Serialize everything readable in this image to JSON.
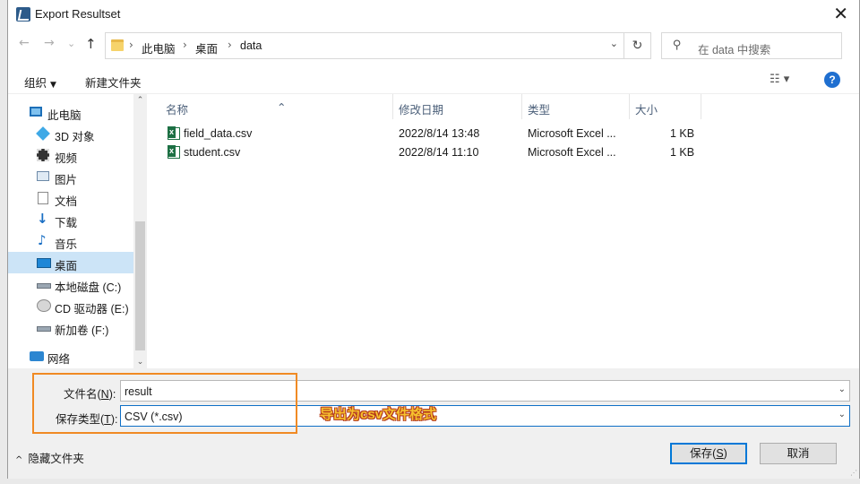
{
  "window": {
    "title": "Export Resultset",
    "close_glyph": "✕"
  },
  "nav_buttons": {
    "back": "←",
    "forward": "→",
    "recent": "⌄",
    "up": "↑"
  },
  "address": {
    "crumbs": [
      "此电脑",
      "桌面",
      "data"
    ],
    "separator": "›",
    "dropdown_glyph": "⌄",
    "refresh_glyph": "↻"
  },
  "search": {
    "placeholder": "在 data 中搜索",
    "icon": "⚲"
  },
  "toolbar": {
    "organize": "组织",
    "organize_arrow": "▼",
    "new_folder": "新建文件夹",
    "view_glyph": "☷ ▾",
    "help_glyph": "?"
  },
  "sidebar": {
    "items": [
      {
        "label": "此电脑",
        "icon": "computer-icon"
      },
      {
        "label": "3D 对象",
        "icon": "cube-icon"
      },
      {
        "label": "视频",
        "icon": "video-icon"
      },
      {
        "label": "图片",
        "icon": "picture-icon"
      },
      {
        "label": "文档",
        "icon": "document-icon"
      },
      {
        "label": "下载",
        "icon": "download-icon"
      },
      {
        "label": "音乐",
        "icon": "music-icon"
      },
      {
        "label": "桌面",
        "icon": "desktop-icon",
        "selected": true
      },
      {
        "label": "本地磁盘 (C:)",
        "icon": "drive-icon"
      },
      {
        "label": "CD 驱动器 (E:)",
        "icon": "cd-drive-icon"
      },
      {
        "label": "新加卷 (F:)",
        "icon": "drive-icon"
      },
      {
        "label": "网络",
        "icon": "network-icon"
      }
    ],
    "scroll_up": "⌃",
    "scroll_down": "⌄"
  },
  "file_list": {
    "columns": [
      "名称",
      "修改日期",
      "类型",
      "大小"
    ],
    "sort_glyph": "⌃",
    "rows": [
      {
        "name": "field_data.csv",
        "date": "2022/8/14 13:48",
        "type": "Microsoft Excel ...",
        "size": "1 KB"
      },
      {
        "name": "student.csv",
        "date": "2022/8/14 11:10",
        "type": "Microsoft Excel ...",
        "size": "1 KB"
      }
    ]
  },
  "form": {
    "filename_label_pre": "文件名(",
    "filename_label_key": "N",
    "filename_label_post": "):",
    "filename_value": "result",
    "filetype_label_pre": "保存类型(",
    "filetype_label_key": "T",
    "filetype_label_post": "):",
    "filetype_value": "CSV (*.csv)",
    "dropdown_glyph": "⌄"
  },
  "annotation": {
    "text": "导出为csv文件格式",
    "color": "#f08a24"
  },
  "footer": {
    "hide_folders": "隐藏文件夹",
    "hide_chevron": "^",
    "save_pre": "保存(",
    "save_key": "S",
    "save_post": ")",
    "cancel": "取消"
  },
  "colors": {
    "accent": "#0078d7",
    "selected_bg": "#cce4f7",
    "header_text": "#4c607a"
  }
}
